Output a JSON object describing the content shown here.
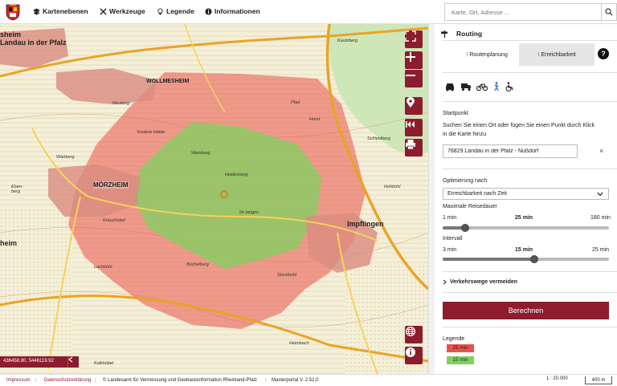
{
  "topbar": {
    "menu": [
      {
        "label": "Kartenebenen",
        "icon": "layers-icon"
      },
      {
        "label": "Werkzeuge",
        "icon": "tools-icon"
      },
      {
        "label": "Legende",
        "icon": "bulb-icon"
      },
      {
        "label": "Informationen",
        "icon": "info-icon"
      }
    ],
    "search_placeholder": "Karte, Ort, Adresse ..."
  },
  "map": {
    "labels": {
      "landau_1": "sheim",
      "landau_2": "Landau in der Pfalz",
      "wollmesheim": "WOLLMESHEIM",
      "morzheim": "MÖRZHEIM",
      "impflingen": "Impflingen",
      "heim_left": "heim",
      "kreuzhubel": "Kreuzhübel",
      "locbuhl": "Lochbühl",
      "kalkhubel": "Kalkhübel",
      "ebenberg": "Eben-\nberg",
      "wartberg": "Wartberg",
      "stockbuhl": "Stockbühl",
      "heimbach": "Heimbach",
      "hohbuhl": "Hohbühl",
      "kautzberg": "Kautzberg",
      "pfad": "Pfad",
      "schleidberg": "Schleidberg",
      "buchelberg": "Büchelberg",
      "weinberg": "Weinberg",
      "heidenberg": "Heidenberg",
      "neuberg": "Neuberg",
      "vordere_haide": "Vordere Haide",
      "im_langen": "Im langen",
      "horst": "Horst"
    },
    "coordinates": "436458.80, 5446119.92",
    "isochrone_colors": {
      "red": "#e9524a",
      "green": "#7fd15e"
    }
  },
  "panel": {
    "title": "Routing",
    "tabs": [
      "Routenplanung",
      "Erreichbarkeit"
    ],
    "active_tab": "Erreichbarkeit",
    "help": "?",
    "modes": [
      "car-icon",
      "truck-icon",
      "bicycle-icon",
      "pedestrian-icon",
      "wheelchair-icon"
    ],
    "active_mode": "pedestrian-icon",
    "startpunkt_label": "Startpunkt",
    "startpunkt_hint": "Suchen Sie einen Ort oder fügen Sie einen Punkt durch Klick in die Karte hinzu",
    "start_value": "76829 Landau in der Pfalz - Nußdorf",
    "optimierung_label": "Optimierung nach",
    "optimierung_value": "Erreichbarkeit nach Zeit",
    "reisedauer": {
      "label": "Maximale Reisedauer",
      "min": "1 min",
      "value": "25 min",
      "max": "180 min",
      "fraction": 0.135
    },
    "intervall": {
      "label": "Intervall",
      "min": "3 min",
      "value": "15 min",
      "max": "25 min",
      "fraction": 0.55
    },
    "avoid_label": "Verkehrswege vermeiden",
    "calc_label": "Berechnen",
    "legend_title": "Legende",
    "legend": [
      {
        "label": "25 min",
        "color": "#e9524a"
      },
      {
        "label": "15 min",
        "color": "#7fd15e"
      }
    ]
  },
  "footer": {
    "impressum": "Impressum",
    "datenschutz": "Datenschutzerklärung",
    "copyright": "© Landesamt für Vermessung und Geobasisinformation Rheinland-Pfalz",
    "version": "Masterportal V. 2.52.0",
    "scale": "1 : 20.000",
    "scale_bar": "400 m"
  }
}
